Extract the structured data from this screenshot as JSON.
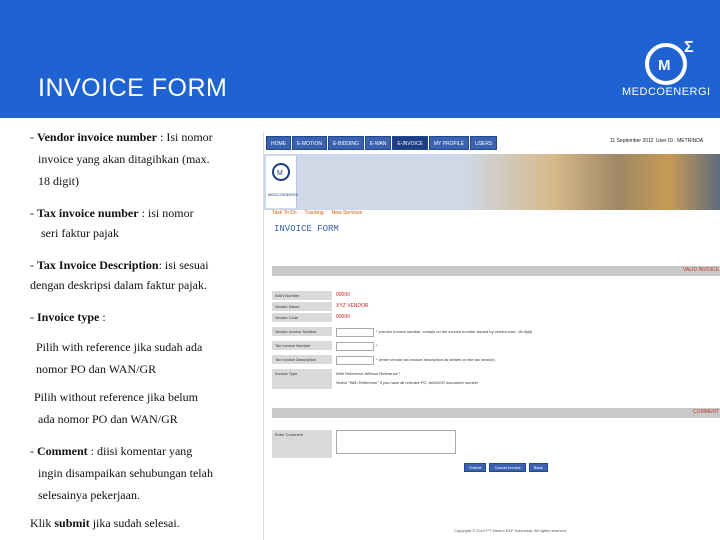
{
  "slide": {
    "title": "INVOICE FORM",
    "brand": "MEDCOENERGI"
  },
  "notes": {
    "l1a": "- ",
    "l1b": "Vendor invoice number",
    "l1c": " : Isi nomor",
    "l2": "invoice yang akan ditagihkan (max.",
    "l3": "18 digit)",
    "l4a": "-   ",
    "l4b": "Tax invoice number",
    "l4c": " : isi nomor",
    "l5": "seri faktur pajak",
    "l6a": "- ",
    "l6b": "Tax Invoice Description",
    "l6c": ": isi sesuai",
    "l7": "dengan deskripsi dalam faktur pajak.",
    "l8a": "- ",
    "l8b": "Invoice type",
    "l8c": " :",
    "l9": "Pilih with reference jika sudah ada",
    "l10": "nomor PO dan WAN/GR",
    "l11": "Pilih without reference jika belum",
    "l12": "ada nomor PO dan WAN/GR",
    "l13a": "- ",
    "l13b": "Comment",
    "l13c": " : diisi komentar yang",
    "l14": "ingin disampaikan sehubungan telah",
    "l15": "selesainya pekerjaan.",
    "l16a": "Klik ",
    "l16b": "submit",
    "l16c": " jika sudah selesai."
  },
  "screenshot": {
    "nav": [
      "HOME",
      "E-MOTION",
      "E-BIDDING",
      "E-WAN",
      "E-INVOICE",
      "MY PROFILE",
      "USERS"
    ],
    "active_nav": "E-INVOICE",
    "date": "11 September 2012",
    "user": "User ID : METRINDA",
    "banner_logo": "MEDCOENERGI",
    "breadcrumb": [
      "Task To Do",
      "Tracking",
      "New Services"
    ],
    "page_heading": "INVOICE FORM",
    "section1": "VALID INVOICE",
    "rows": [
      {
        "label": "WAN Number",
        "value": "00000"
      },
      {
        "label": "Vendor Name",
        "value": "XYZ VENDOR"
      },
      {
        "label": "Vendor Code",
        "value": "00000"
      },
      {
        "label": "Vendor Invoice Number",
        "hint": "* (vendor invoice number, comply on the invoice number issued by vendor max. 18 digit)"
      },
      {
        "label": "Tax Invoice Number",
        "hint": "*"
      },
      {
        "label": "Tax Invoice Description",
        "hint": "* (enter vendor tax invoice description as written on the tax invoice)"
      },
      {
        "label": "Invoice Type",
        "hint": "With Reference   Without Reference *"
      }
    ],
    "invoice_type_note": "Select \"With Reference\" if you have all relevant PO, WAN/GR document number",
    "section2": "COMMENT",
    "comment_label": "Enter Comment",
    "buttons": [
      "Submit",
      "Cancel Invoice",
      "Back"
    ],
    "footer": "Copyright © 2012 PT Medco E&P Indonesia. All rights reserved."
  },
  "colors": {
    "header_blue": "#1f63d3",
    "nav_blue": "#3a62b0"
  }
}
